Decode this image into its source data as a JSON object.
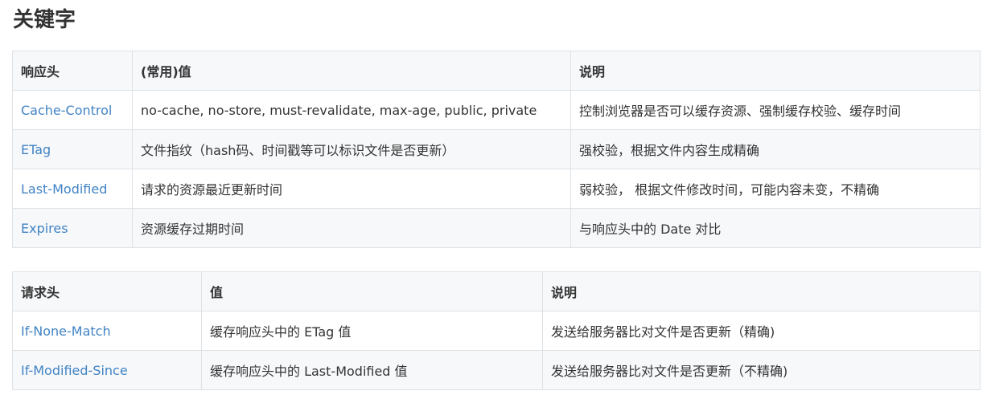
{
  "heading": "关键字",
  "response_table": {
    "headers": [
      "响应头",
      "(常用)值",
      "说明"
    ],
    "rows": [
      {
        "key": "Cache-Control",
        "value": "no-cache, no-store, must-revalidate, max-age, public, private",
        "desc": "控制浏览器是否可以缓存资源、强制缓存校验、缓存时间"
      },
      {
        "key": "ETag",
        "value": "文件指纹（hash码、时间戳等可以标识文件是否更新）",
        "desc": "强校验，根据文件内容生成精确"
      },
      {
        "key": "Last-Modified",
        "value": "请求的资源最近更新时间",
        "desc": "弱校验， 根据文件修改时间，可能内容未变，不精确"
      },
      {
        "key": "Expires",
        "value": "资源缓存过期时间",
        "desc": "与响应头中的 Date 对比"
      }
    ]
  },
  "request_table": {
    "headers": [
      "请求头",
      "值",
      "说明"
    ],
    "rows": [
      {
        "key": "If-None-Match",
        "value": "缓存响应头中的 ETag 值",
        "desc": "发送给服务器比对文件是否更新（精确)"
      },
      {
        "key": "If-Modified-Since",
        "value": "缓存响应头中的 Last-Modified 值",
        "desc": "发送给服务器比对文件是否更新（不精确)"
      }
    ]
  },
  "colors": {
    "link": "#4183c4",
    "text": "#333333",
    "border": "#dfe2e5",
    "stripe": "#f6f8fa"
  }
}
